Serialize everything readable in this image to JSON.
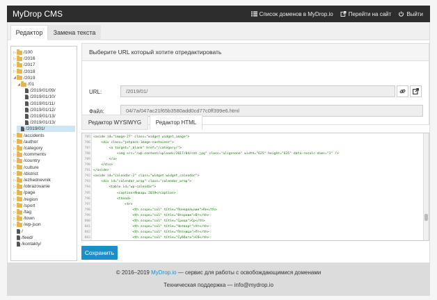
{
  "app": {
    "title": "MyDrop CMS",
    "nav": [
      {
        "label": "Список доменов в MyDrop.io",
        "icon": "list-icon"
      },
      {
        "label": "Перейти на сайт",
        "icon": "external-link-icon"
      },
      {
        "label": "Выйти",
        "icon": "power-icon"
      }
    ]
  },
  "tabs": [
    {
      "label": "Редактор",
      "active": true
    },
    {
      "label": "Замена текста",
      "active": false
    }
  ],
  "tree": [
    {
      "label": "/100",
      "type": "folder",
      "level": 0,
      "expanded": false
    },
    {
      "label": "/2016",
      "type": "folder",
      "level": 0,
      "expanded": false
    },
    {
      "label": "/2017",
      "type": "folder",
      "level": 0,
      "expanded": false
    },
    {
      "label": "/2018",
      "type": "folder",
      "level": 0,
      "expanded": false
    },
    {
      "label": "/2019",
      "type": "folder",
      "level": 0,
      "expanded": true
    },
    {
      "label": "/01",
      "type": "folder",
      "level": 1,
      "expanded": true
    },
    {
      "label": "/2019/01/09/",
      "type": "file",
      "level": 2
    },
    {
      "label": "/2019/01/10/",
      "type": "file",
      "level": 2
    },
    {
      "label": "/2019/01/11/",
      "type": "file",
      "level": 2
    },
    {
      "label": "/2019/01/12/",
      "type": "file",
      "level": 2
    },
    {
      "label": "/2019/01/13/",
      "type": "file",
      "level": 2
    },
    {
      "label": "/2019/01/13/",
      "type": "file",
      "level": 2
    },
    {
      "label": "/2019/01/",
      "type": "file",
      "level": 1,
      "selected": true
    },
    {
      "label": "/accidents",
      "type": "folder",
      "level": 0,
      "expanded": false
    },
    {
      "label": "/author",
      "type": "folder",
      "level": 0,
      "expanded": false
    },
    {
      "label": "/category",
      "type": "folder",
      "level": 0,
      "expanded": false
    },
    {
      "label": "/comments",
      "type": "folder",
      "level": 0,
      "expanded": false
    },
    {
      "label": "/country",
      "type": "folder",
      "level": 0,
      "expanded": false
    },
    {
      "label": "/culture",
      "type": "folder",
      "level": 0,
      "expanded": false
    },
    {
      "label": "/district",
      "type": "folder",
      "level": 0,
      "expanded": false
    },
    {
      "label": "/ezhednevnik",
      "type": "folder",
      "level": 0,
      "expanded": false
    },
    {
      "label": "/obrazovanie",
      "type": "folder",
      "level": 0,
      "expanded": false
    },
    {
      "label": "/page",
      "type": "folder",
      "level": 0,
      "expanded": false
    },
    {
      "label": "/region",
      "type": "folder",
      "level": 0,
      "expanded": false
    },
    {
      "label": "/sport",
      "type": "folder",
      "level": 0,
      "expanded": false
    },
    {
      "label": "/tag",
      "type": "folder",
      "level": 0,
      "expanded": false
    },
    {
      "label": "/town",
      "type": "folder",
      "level": 0,
      "expanded": false
    },
    {
      "label": "/wp-json",
      "type": "folder",
      "level": 0,
      "expanded": false
    },
    {
      "label": "/",
      "type": "file",
      "level": 0
    },
    {
      "label": "/feed/",
      "type": "file",
      "level": 0
    },
    {
      "label": "/kontakty/",
      "type": "file",
      "level": 0
    }
  ],
  "url_panel": {
    "heading": "Выберите URL который хотите отредактировать",
    "url_label": "URL:",
    "url_value": "/2019/01/",
    "file_label": "Файл:",
    "file_value": "04/7a/047ac21f65b3580add0cd77c0ff399e6.html"
  },
  "editor_tabs": [
    {
      "label": "Редактор WYSIWYG",
      "active": false
    },
    {
      "label": "Редактор HTML",
      "active": true
    }
  ],
  "code_lines": [
    {
      "num": "785",
      "text": "<aside id=\"image-27\" class=\"widget widget_image\">"
    },
    {
      "num": "786",
      "text": "    <div class=\"jetpack-image-container\">"
    },
    {
      "num": "787",
      "text": "        <a target=\"_blank\" href=\"/category/\">"
    },
    {
      "num": "788",
      "text": "            <img src=\"/wp-content/uploads/2017/04/cat.jpg\" class=\"alignnone\" width=\"625\" height=\"625\" data-recalc-dims=\"1\" />"
    },
    {
      "num": "789",
      "text": "        </a>"
    },
    {
      "num": "790",
      "text": "    </div>"
    },
    {
      "num": "791",
      "text": "</aside>"
    },
    {
      "num": "792",
      "text": "<aside id=\"calendar-2\" class=\"widget widget_calendar\">"
    },
    {
      "num": "793",
      "text": "    <div id=\"calendar_wrap\" class=\"calendar_wrap\">"
    },
    {
      "num": "794",
      "text": "        <table id=\"wp-calendar\">"
    },
    {
      "num": "795",
      "text": "            <caption>Январь 2019</caption>"
    },
    {
      "num": "796",
      "text": "            <thead>"
    },
    {
      "num": "797",
      "text": "                <tr>"
    },
    {
      "num": "798",
      "text": "                    <th scope=\"col\" title=\"Понедельник\">Пн</th>"
    },
    {
      "num": "799",
      "text": "                    <th scope=\"col\" title=\"Вторник\">Вт</th>"
    },
    {
      "num": "800",
      "text": "                    <th scope=\"col\" title=\"Среда\">Ср</th>"
    },
    {
      "num": "801",
      "text": "                    <th scope=\"col\" title=\"Четверг\">Чт</th>"
    },
    {
      "num": "802",
      "text": "                    <th scope=\"col\" title=\"Пятница\">Пт</th>"
    },
    {
      "num": "803",
      "text": "                    <th scope=\"col\" title=\"Суббота\">Сб</th>"
    }
  ],
  "save_label": "Сохранить",
  "footer": {
    "copyright_pre": "© 2016–2019 ",
    "copyright_link": "MyDrop.io",
    "copyright_post": " — сервис для работы с освобождающимися доменами",
    "support": "Техническая поддержка — info@mydrop.io"
  },
  "colors": {
    "navbar": "#2d2d2d",
    "primary": "#1a8fc9",
    "folder": "#e7b54a",
    "selected": "#cce6f5"
  }
}
